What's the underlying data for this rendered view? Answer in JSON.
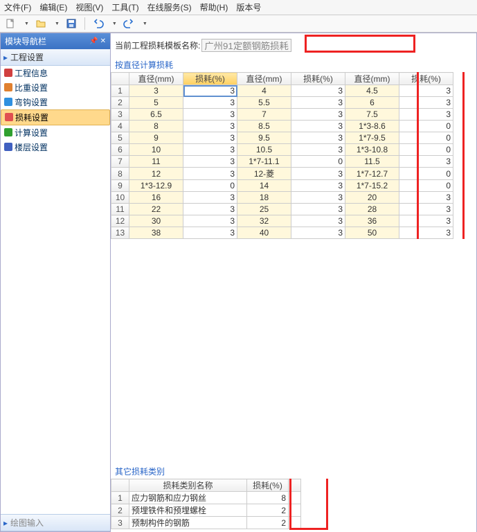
{
  "menus": [
    "文件(F)",
    "编辑(E)",
    "视图(V)",
    "工具(T)",
    "在线服务(S)",
    "帮助(H)",
    "版本号"
  ],
  "nav": {
    "title": "模块导航栏",
    "group": "工程设置",
    "items": [
      {
        "label": "工程信息"
      },
      {
        "label": "比重设置"
      },
      {
        "label": "弯钩设置"
      },
      {
        "label": "损耗设置",
        "selected": true
      },
      {
        "label": "计算设置"
      },
      {
        "label": "楼层设置"
      }
    ]
  },
  "template": {
    "label": "当前工程损耗模板名称:",
    "value": "广州91定额钢筋损耗"
  },
  "section1_title": "按直径计算损耗",
  "headers": [
    "直径(mm)",
    "损耗(%)",
    "直径(mm)",
    "损耗(%)",
    "直径(mm)",
    "损耗(%)"
  ],
  "rows": [
    [
      "3",
      "3",
      "4",
      "3",
      "4.5",
      "3"
    ],
    [
      "5",
      "3",
      "5.5",
      "3",
      "6",
      "3"
    ],
    [
      "6.5",
      "3",
      "7",
      "3",
      "7.5",
      "3"
    ],
    [
      "8",
      "3",
      "8.5",
      "3",
      "1*3-8.6",
      "0"
    ],
    [
      "9",
      "3",
      "9.5",
      "3",
      "1*7-9.5",
      "0"
    ],
    [
      "10",
      "3",
      "10.5",
      "3",
      "1*3-10.8",
      "0"
    ],
    [
      "11",
      "3",
      "1*7-11.1",
      "0",
      "11.5",
      "3"
    ],
    [
      "12",
      "3",
      "12-菱",
      "3",
      "1*7-12.7",
      "0"
    ],
    [
      "1*3-12.9",
      "0",
      "14",
      "3",
      "1*7-15.2",
      "0"
    ],
    [
      "16",
      "3",
      "18",
      "3",
      "20",
      "3"
    ],
    [
      "22",
      "3",
      "25",
      "3",
      "28",
      "3"
    ],
    [
      "30",
      "3",
      "32",
      "3",
      "36",
      "3"
    ],
    [
      "38",
      "3",
      "40",
      "3",
      "50",
      "3"
    ]
  ],
  "section2_title": "其它损耗类别",
  "headers2": [
    "损耗类别名称",
    "损耗(%)"
  ],
  "rows2": [
    [
      "应力钢筋和应力钢丝",
      "8"
    ],
    [
      "预埋铁件和预埋螺栓",
      "2"
    ],
    [
      "预制构件的钢筋",
      "2"
    ]
  ]
}
